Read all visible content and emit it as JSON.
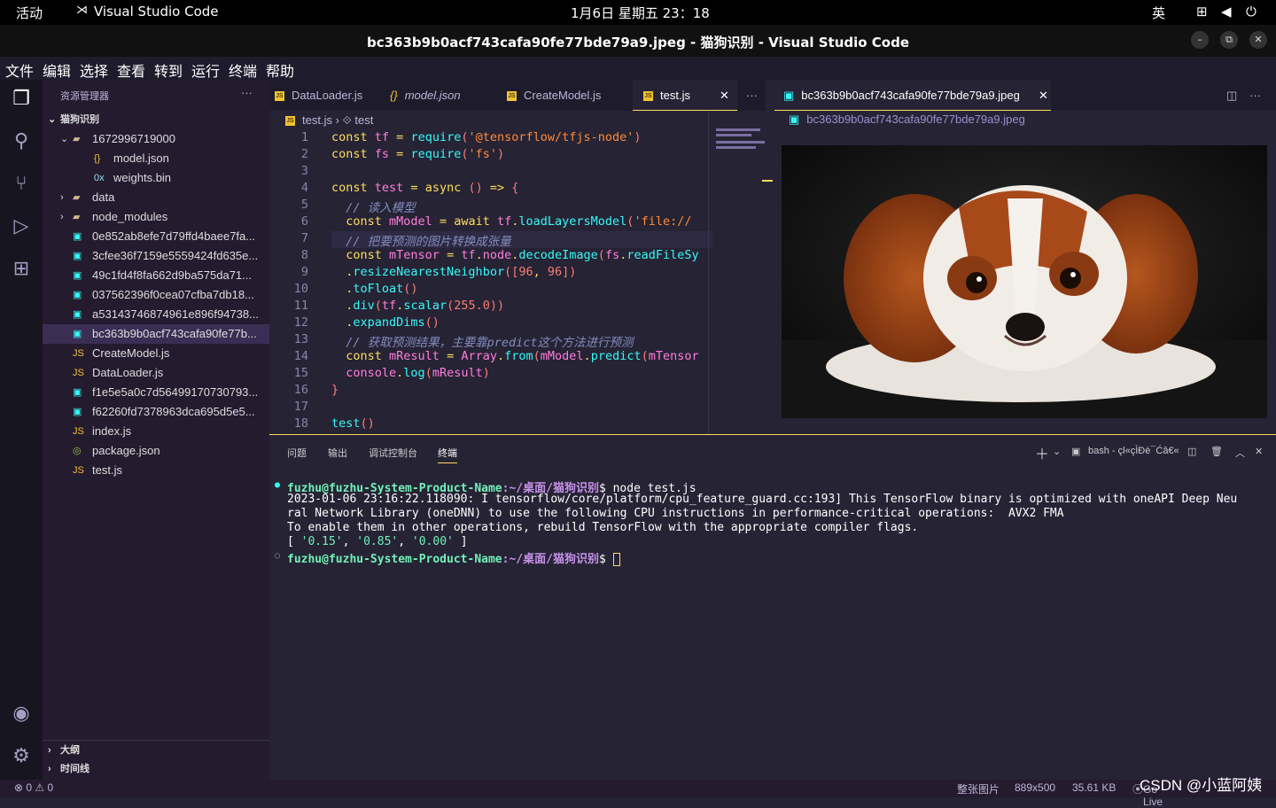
{
  "system": {
    "activities": "活动",
    "app": "Visual Studio Code",
    "datetime": "1月6日 星期五 23：18",
    "lang": "英"
  },
  "window": {
    "title": "bc363b9b0acf743cafa90fe77bde79a9.jpeg - 猫狗识别 - Visual Studio Code",
    "minimize": "–",
    "restore": "⧉",
    "close": "✕"
  },
  "menu": [
    "文件",
    "编辑",
    "选择",
    "查看",
    "转到",
    "运行",
    "终端",
    "帮助"
  ],
  "sidebar": {
    "title": "资源管理器",
    "more": "···",
    "root": "猫狗识别",
    "items": [
      {
        "label": "1672996719000",
        "icon": "folder-icon",
        "glyph": "▰"
      },
      {
        "label": "model.json",
        "icon": "json-icon",
        "glyph": "{}"
      },
      {
        "label": "weights.bin",
        "icon": "binary-icon",
        "glyph": "0x"
      },
      {
        "label": "data",
        "icon": "folder-icon",
        "glyph": "▰"
      },
      {
        "label": "node_modules",
        "icon": "folder-icon",
        "glyph": "▰"
      },
      {
        "label": "0e852ab8efe7d79ffd4baee7fa...",
        "icon": "image-icon",
        "glyph": "▣"
      },
      {
        "label": "3cfee36f7159e5559424fd635e...",
        "icon": "image-icon",
        "glyph": "▣"
      },
      {
        "label": "49c1fd4f8fa662d9ba575da71...",
        "icon": "image-icon",
        "glyph": "▣"
      },
      {
        "label": "037562396f0cea07cfba7db18...",
        "icon": "image-icon",
        "glyph": "▣"
      },
      {
        "label": "a53143746874961e896f94738...",
        "icon": "image-icon",
        "glyph": "▣"
      },
      {
        "label": "bc363b9b0acf743cafa90fe77b...",
        "icon": "image-icon",
        "glyph": "▣"
      },
      {
        "label": "CreateModel.js",
        "icon": "js-icon",
        "glyph": "JS"
      },
      {
        "label": "DataLoader.js",
        "icon": "js-icon",
        "glyph": "JS"
      },
      {
        "label": "f1e5e5a0c7d56499170730793...",
        "icon": "image-icon",
        "glyph": "▣"
      },
      {
        "label": "f62260fd7378963dca695d5e5...",
        "icon": "image-icon",
        "glyph": "▣"
      },
      {
        "label": "index.js",
        "icon": "js-icon",
        "glyph": "JS"
      },
      {
        "label": "package.json",
        "icon": "npm-icon",
        "glyph": "◎"
      },
      {
        "label": "test.js",
        "icon": "js-icon",
        "glyph": "JS"
      }
    ],
    "outline": "大纲",
    "timeline": "时间线"
  },
  "tabs": [
    "DataLoader.js",
    "model.json",
    "CreateModel.js",
    "test.js"
  ],
  "tab_close": "✕",
  "breadcrumb": {
    "file": "test.js",
    "symbol": "test"
  },
  "code": [
    [
      [
        "kw",
        "const "
      ],
      [
        "vr",
        "tf "
      ],
      [
        "kw",
        "= "
      ],
      [
        "fn",
        "require"
      ],
      [
        "pn",
        "("
      ],
      [
        "str",
        "'@tensorflow/tfjs-node'"
      ],
      [
        "pn",
        ")"
      ]
    ],
    [
      [
        "kw",
        "const "
      ],
      [
        "vr",
        "fs "
      ],
      [
        "kw",
        "= "
      ],
      [
        "fn",
        "require"
      ],
      [
        "pn",
        "("
      ],
      [
        "str",
        "'fs'"
      ],
      [
        "pn",
        ")"
      ]
    ],
    [],
    [
      [
        "kw",
        "const "
      ],
      [
        "vr",
        "test "
      ],
      [
        "kw",
        "= "
      ],
      [
        "kw",
        "async "
      ],
      [
        "pn",
        "() "
      ],
      [
        "kw",
        "=> "
      ],
      [
        "pn",
        "{"
      ]
    ],
    [
      [
        "cm",
        "  // 读入模型"
      ]
    ],
    [
      [
        "kw",
        "  const "
      ],
      [
        "vr",
        "mModel "
      ],
      [
        "kw",
        "= await "
      ],
      [
        "vr",
        "tf"
      ],
      [
        "kw",
        "."
      ],
      [
        "fn",
        "loadLayersModel"
      ],
      [
        "pn",
        "("
      ],
      [
        "str",
        "'file://"
      ]
    ],
    [
      [
        "cm",
        "  // 把要预测的图片转换成张量"
      ]
    ],
    [
      [
        "kw",
        "  const "
      ],
      [
        "vr",
        "mTensor "
      ],
      [
        "kw",
        "= "
      ],
      [
        "vr",
        "tf"
      ],
      [
        "kw",
        "."
      ],
      [
        "vr",
        "node"
      ],
      [
        "kw",
        "."
      ],
      [
        "fn",
        "decodeImage"
      ],
      [
        "pn",
        "("
      ],
      [
        "vr",
        "fs"
      ],
      [
        "kw",
        "."
      ],
      [
        "fn",
        "readFileSy"
      ]
    ],
    [
      [
        "kw",
        "  ."
      ],
      [
        "fn",
        "resizeNearestNeighbor"
      ],
      [
        "pn",
        "(["
      ],
      [
        "num",
        "96"
      ],
      [
        "kw",
        ", "
      ],
      [
        "num",
        "96"
      ],
      [
        "pn",
        "])"
      ]
    ],
    [
      [
        "kw",
        "  ."
      ],
      [
        "fn",
        "toFloat"
      ],
      [
        "pn",
        "()"
      ]
    ],
    [
      [
        "kw",
        "  ."
      ],
      [
        "fn",
        "div"
      ],
      [
        "pn",
        "("
      ],
      [
        "vr",
        "tf"
      ],
      [
        "kw",
        "."
      ],
      [
        "fn",
        "scalar"
      ],
      [
        "pn",
        "("
      ],
      [
        "num",
        "255.0"
      ],
      [
        "pn",
        "))"
      ]
    ],
    [
      [
        "kw",
        "  ."
      ],
      [
        "fn",
        "expandDims"
      ],
      [
        "pn",
        "()"
      ]
    ],
    [
      [
        "cm",
        "  // 获取预测结果，主要靠predict这个方法进行预测"
      ]
    ],
    [
      [
        "kw",
        "  const "
      ],
      [
        "vr",
        "mResult "
      ],
      [
        "kw",
        "= "
      ],
      [
        "vr",
        "Array"
      ],
      [
        "kw",
        "."
      ],
      [
        "fn",
        "from"
      ],
      [
        "pn",
        "("
      ],
      [
        "vr",
        "mModel"
      ],
      [
        "kw",
        "."
      ],
      [
        "fn",
        "predict"
      ],
      [
        "pn",
        "("
      ],
      [
        "vr",
        "mTensor"
      ]
    ],
    [
      [
        "vr",
        "  console"
      ],
      [
        "kw",
        "."
      ],
      [
        "fn",
        "log"
      ],
      [
        "pn",
        "("
      ],
      [
        "vr",
        "mResult"
      ],
      [
        "pn",
        ")"
      ]
    ],
    [
      [
        "pn",
        "}"
      ]
    ],
    [],
    [
      [
        "fn",
        "test"
      ],
      [
        "pn",
        "()"
      ]
    ]
  ],
  "image_tab": "bc363b9b0acf743cafa90fe77bde79a9.jpeg",
  "image_breadcrumb": "bc363b9b0acf743cafa90fe77bde79a9.jpeg",
  "panel": {
    "tabs": [
      "问题",
      "输出",
      "调试控制台",
      "终端"
    ],
    "shell": "bash - çl«çÌĐè¯Ćâ€«",
    "prompt_user": "fuzhu@fuzhu-System-Product-Name",
    "prompt_path": ":~/桌面/猫狗识别",
    "cmd": "$ node test.js",
    "lines": [
      "2023-01-06 23:16:22.118090: I tensorflow/core/platform/cpu_feature_guard.cc:193] This TensorFlow binary is optimized with oneAPI Deep Neu",
      "ral Network Library (oneDNN) to use the following CPU instructions in performance-critical operations:  AVX2 FMA",
      "To enable them in other operations, rebuild TensorFlow with the appropriate compiler flags."
    ],
    "result_open": "[ ",
    "result_vals": [
      "'0.15'",
      "'0.85'",
      "'0.00'"
    ],
    "result_close": " ]",
    "prompt2": "$ "
  },
  "status": {
    "errors": "⊗ 0 ⚠ 0",
    "img_label": "整张图片",
    "dims": "889x500",
    "size": "35.61 KB",
    "golive": "Go Live",
    "watermark": "CSDN @小蓝阿姨"
  }
}
